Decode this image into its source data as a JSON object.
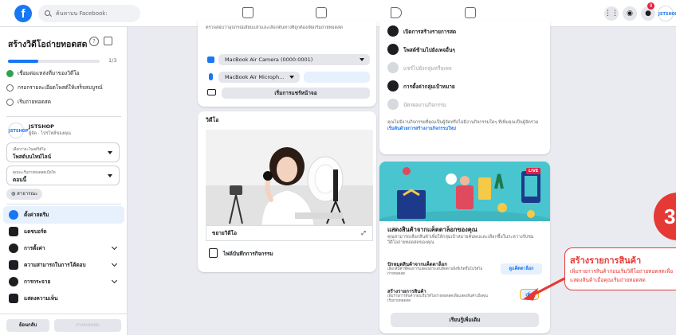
{
  "topbar": {
    "search_placeholder": "ค้นหาบน Facebook:",
    "notification_count": "9",
    "profile_label": "JSTSHOP"
  },
  "sidebar": {
    "title": "สร้างวิดีโอถ่ายทอดสด",
    "help": "?",
    "progress_fraction": 0.33,
    "progress_label": "1/3",
    "steps": [
      {
        "label": "เชื่อมต่อแหล่งที่มาของวิดีโอ",
        "done": true
      },
      {
        "label": "กรอกรายละเอียดโพสต์ให้เสร็จสมบูรณ์",
        "done": false
      },
      {
        "label": "เริ่มถ่ายทอดสด",
        "done": false
      }
    ],
    "account": {
      "avatar": "JSTSHOP",
      "name": "JSTSHOP",
      "sub": "ผู้จัด · ไปรไฟล์ของคุณ"
    },
    "post_type": {
      "label": "เลือกว่าจะโพสต์วิดีโอ",
      "value": "โพสต์บนไทม์ไลน์"
    },
    "schedule": {
      "label": "คุณจะเริ่มถ่ายทอดสดเมื่อใด",
      "value": "ตอนนี้"
    },
    "privacy_chip": "สาธารณะ",
    "menu": [
      {
        "label": "ตั้งค่าสตรีม",
        "active": true,
        "chevron": false
      },
      {
        "label": "แดชบอร์ด",
        "active": false,
        "chevron": false
      },
      {
        "label": "การตั้งค่า",
        "active": false,
        "chevron": true
      },
      {
        "label": "ความสามารถในการโต้ตอบ",
        "active": false,
        "chevron": true
      },
      {
        "label": "การกระจาย",
        "active": false,
        "chevron": true
      },
      {
        "label": "แสดงความเห็น",
        "active": false,
        "chevron": false
      }
    ],
    "back_button": "ย้อนกลับ",
    "go_live_button": "ถ่ายทอดสด"
  },
  "source_card": {
    "top_text": "ตรวจสอบว่าอุปกรณ์เสียบแล้วและเลือกต้นทางที่ถูกต้องเพื่อเริ่มถ่ายทอดสด",
    "camera": "MacBook Air Camera (0000:0001)",
    "microphone": "MacBook Air Microph...",
    "share_screen": "เริ่มการแชร์หน้าจอ"
  },
  "video_card": {
    "title": "วิดีโอ",
    "fullscreen_label": "ขยายวิดีโอ",
    "recording_label": "ไฟล์บันทึกการกิจกรรม"
  },
  "features_card": {
    "items": [
      {
        "label": "เปิดการสร้างรายการสด",
        "enabled": true
      },
      {
        "label": "โพสต์ข้ามไปยังเพจอื่นๆ",
        "enabled": true
      },
      {
        "label": "แชร์ไปยังกลุ่มหรือเพจ",
        "enabled": false
      },
      {
        "label": "การตั้งค่ากลุ่มเป้าหมาย",
        "enabled": true
      },
      {
        "label": "บัตรผลงานกิจกรรม",
        "enabled": false
      }
    ],
    "note": "คุณไม่มีงานกิจกรรมที่คุณเป็นผู้จัดหรือไม่มีงานกิจกรรมใดๆ ที่เพิ่มคุณเป็นผู้จัดร่วม",
    "note_link": "เริ่มต้นด้วยการสร้างงานกิจกรรมใหม่"
  },
  "catalog_card": {
    "live_badge": "LIVE",
    "title": "แสดงสินค้าจากแค็ตตาล็อกของคุณ",
    "description": "คุณสามารถเลือกสินค้าเพื่อให้กลุ่มเป้าหมายค้นพบและเลือกซื้อในระหว่างรับชมวิดีโอถ่ายทอดสดของคุณ",
    "pin_title": "ปักหมุดสินค้าจากแค็ตตาล็อก",
    "pin_desc": "เลือกสินค้าที่ต้องการแสดงอย่างเด่นชัดตามสิ่งที่เกิดขึ้นในวิดีโอถ่ายทอดสด",
    "pin_button": "ดูแค็ตตาล็อก",
    "create_title": "สร้างรายการสินค้า",
    "create_desc": "เพิ่มรายการสินค้าก่อนเริ่มวิดีโอถ่ายทอดสดเพื่อแสดงสินค้าเมื่อคุณเริ่มถ่ายทอดสด",
    "add_button": "เพิ่ม",
    "learn_more": "เรียนรู้เพิ่มเติม"
  },
  "annotation": {
    "step_number": "3",
    "title": "สร้างรายการสินค้า",
    "line1": "เพิ่มรายการสินค้าก่อนเริ่มวิดีโอถ่ายทอดสดเพื่อ",
    "line2": "แสดงสินค้าเมื่อคุณเริ่มถ่ายทอดสด",
    "color": "#e53935"
  },
  "colors": {
    "brand": "#1877f2",
    "success": "#31a24c",
    "annotation": "#e53935",
    "promo_bg": "#48c5cf"
  }
}
